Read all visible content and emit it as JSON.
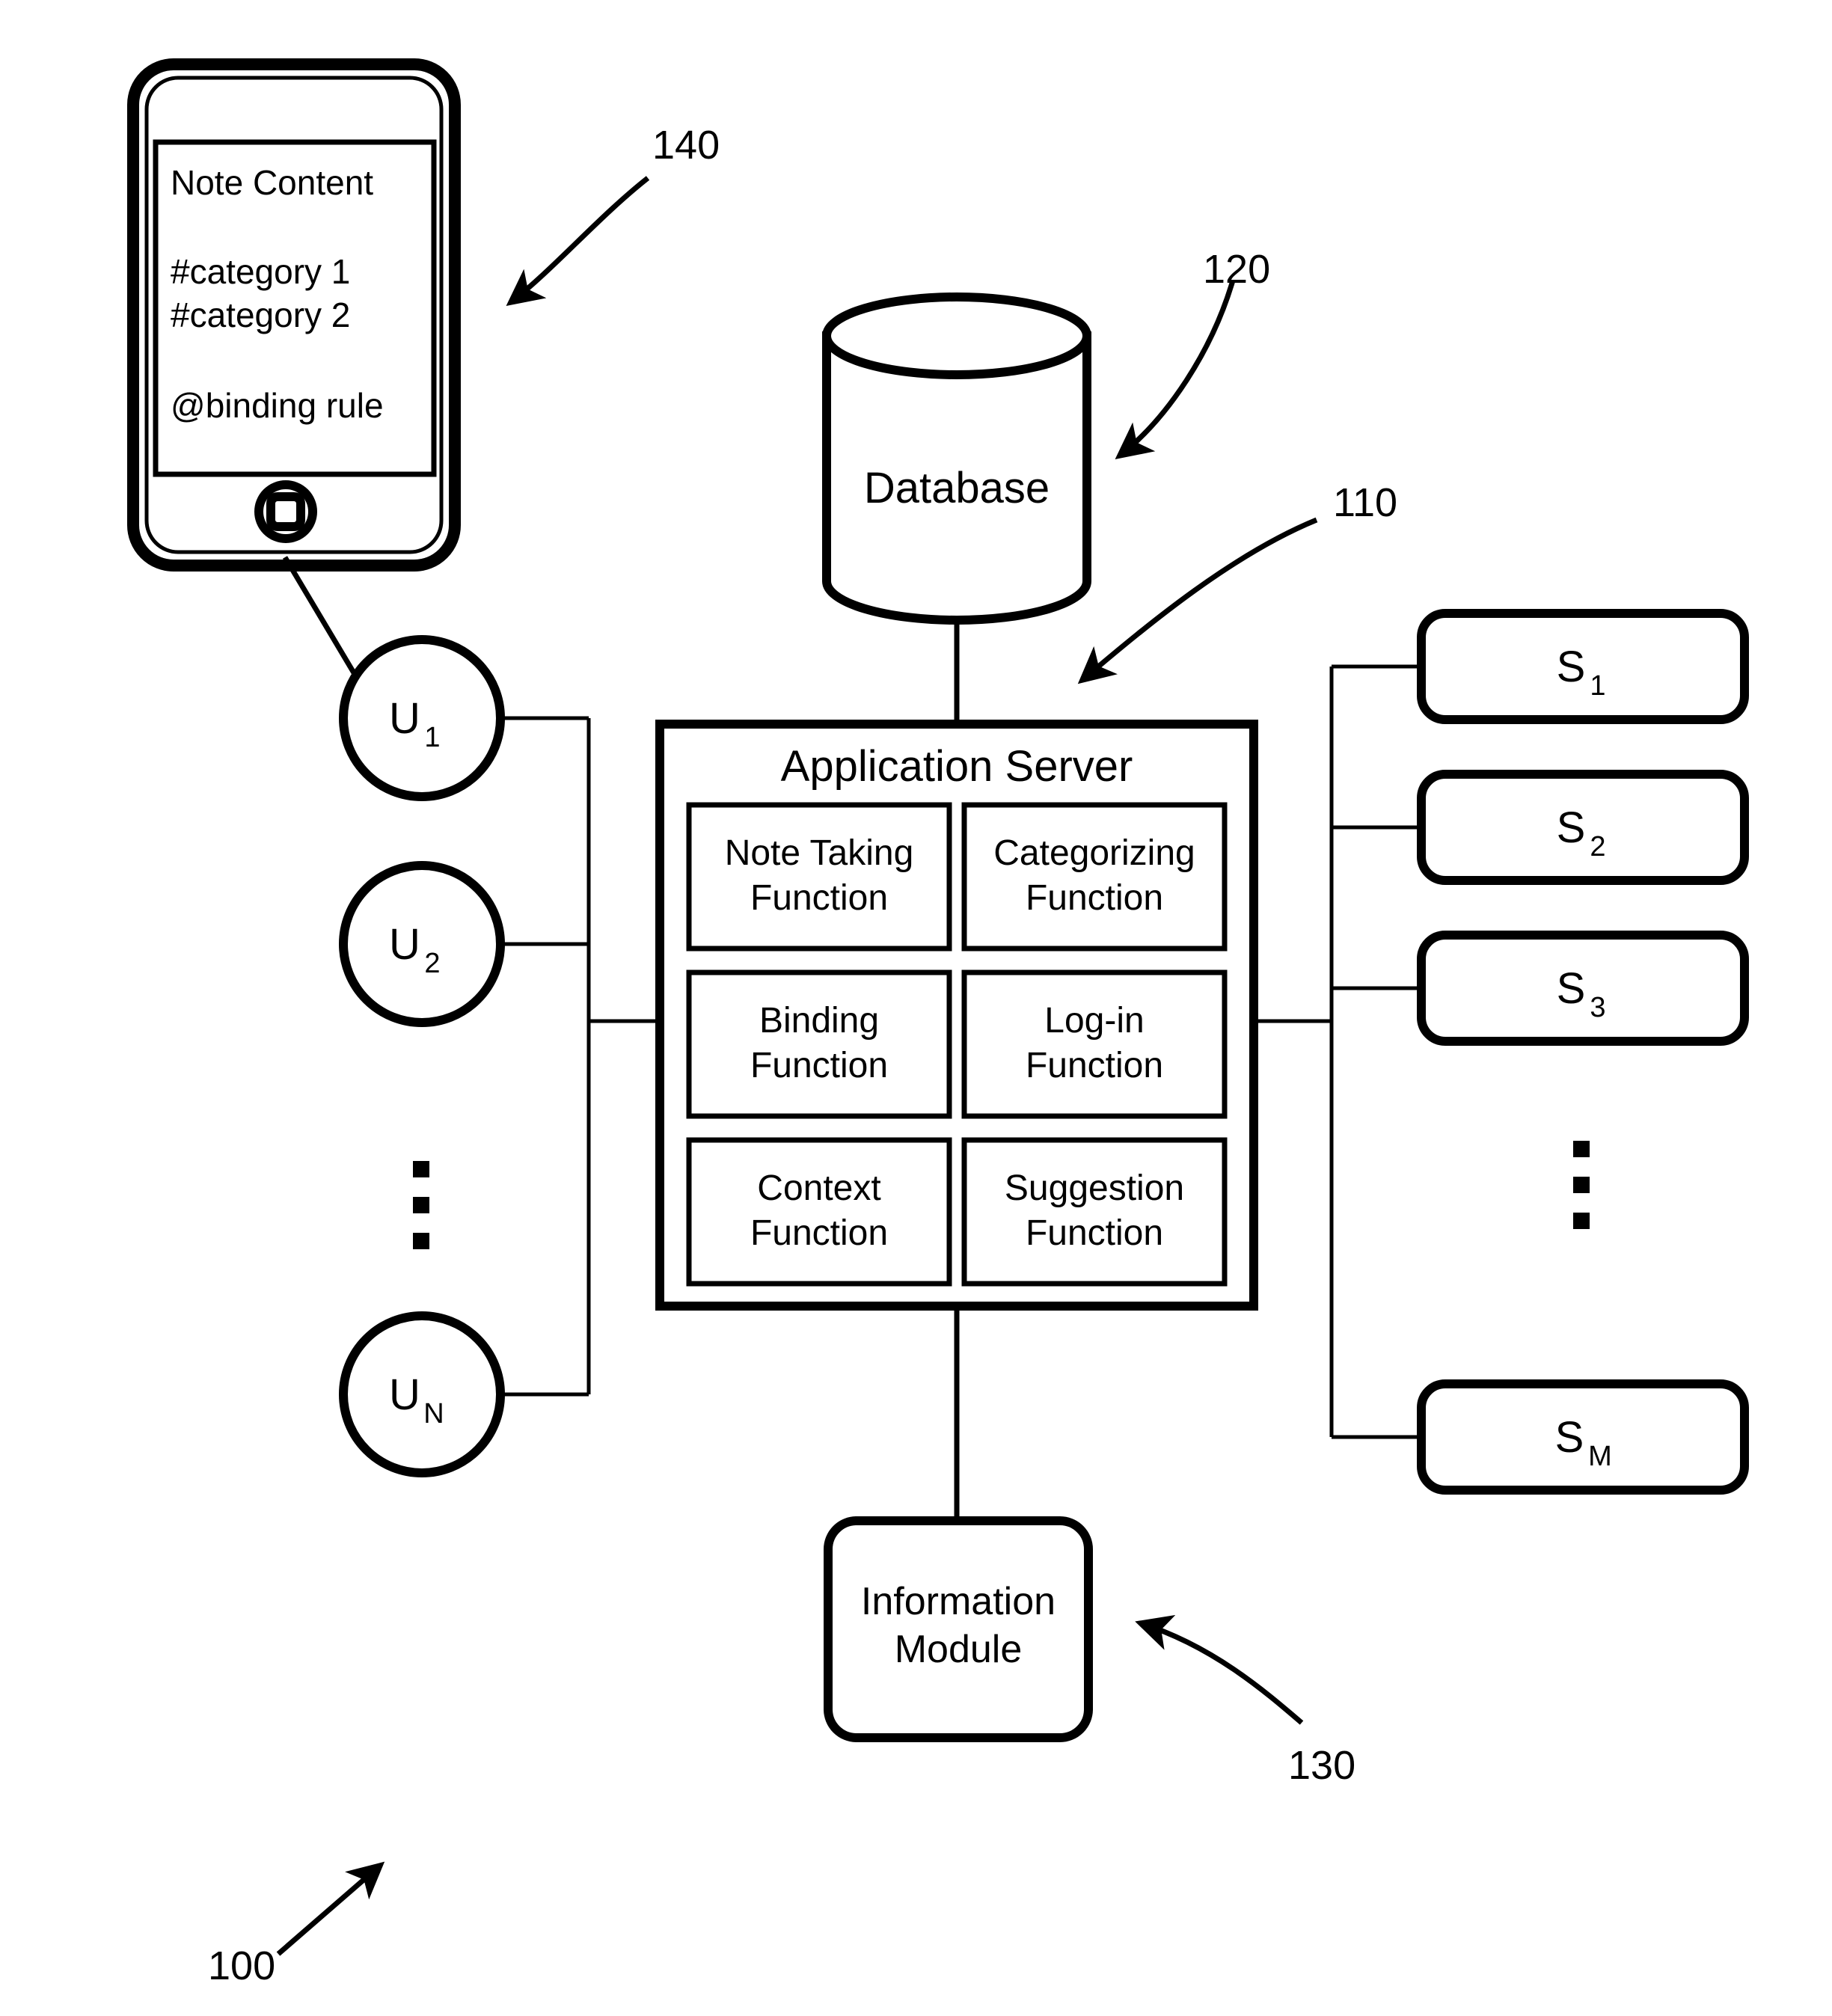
{
  "figure": {
    "reference_numerals": [
      {
        "id": "ref-100",
        "label": "100"
      },
      {
        "id": "ref-110",
        "label": "110"
      },
      {
        "id": "ref-120",
        "label": "120"
      },
      {
        "id": "ref-130",
        "label": "130"
      },
      {
        "id": "ref-140",
        "label": "140"
      }
    ]
  },
  "device": {
    "ref": "140",
    "screen": {
      "title": "Note Content",
      "category_1": "#category 1",
      "category_2": "#category 2",
      "binding_rule": "@binding rule"
    }
  },
  "database": {
    "ref": "120",
    "label": "Database"
  },
  "application_server": {
    "ref": "110",
    "title": "Application Server",
    "functions": [
      {
        "line1": "Note Taking",
        "line2": "Function"
      },
      {
        "line1": "Categorizing",
        "line2": "Function"
      },
      {
        "line1": "Binding",
        "line2": "Function"
      },
      {
        "line1": "Log-in",
        "line2": "Function"
      },
      {
        "line1": "Context",
        "line2": "Function"
      },
      {
        "line1": "Suggestion",
        "line2": "Function"
      }
    ]
  },
  "information_module": {
    "ref": "130",
    "line1": "Information",
    "line2": "Module"
  },
  "users": [
    {
      "base": "U",
      "sub": "1"
    },
    {
      "base": "U",
      "sub": "2"
    },
    {
      "base": "U",
      "sub": "N"
    }
  ],
  "users_ellipsis": "⋮",
  "servers": [
    {
      "base": "S",
      "sub": "1"
    },
    {
      "base": "S",
      "sub": "2"
    },
    {
      "base": "S",
      "sub": "3"
    },
    {
      "base": "S",
      "sub": "M"
    }
  ],
  "servers_ellipsis": "⋮",
  "colors": {
    "ink": "#000000",
    "paper": "#ffffff",
    "device_body": "#d9d9d9"
  }
}
